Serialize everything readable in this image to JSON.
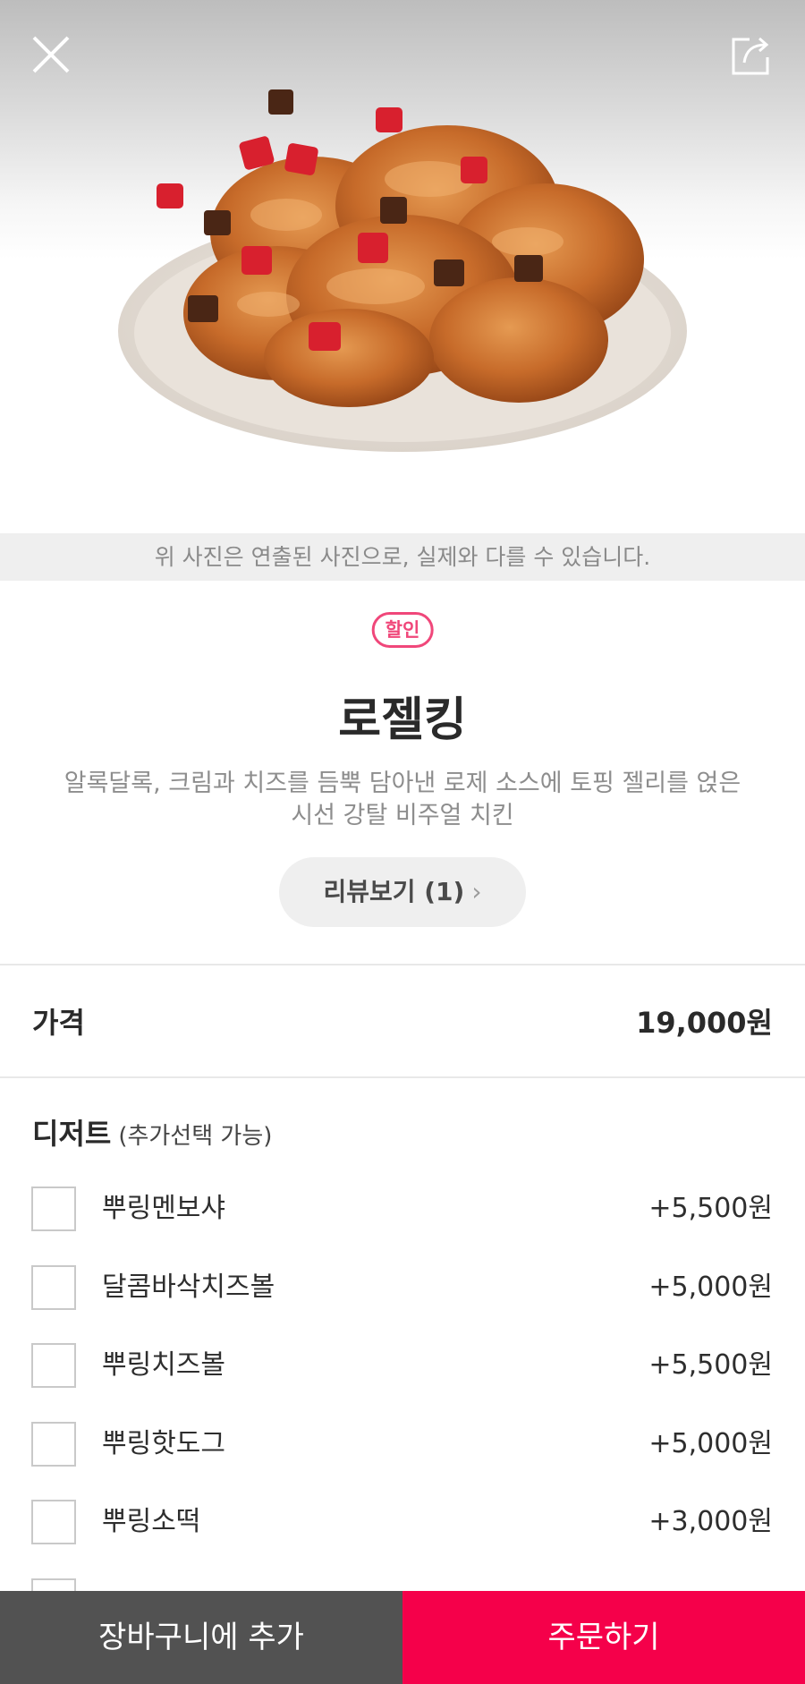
{
  "header": {
    "close_icon": "close-icon",
    "share_icon": "share-icon"
  },
  "photo": {
    "notice": "위 사진은 연출된 사진으로, 실제와 다를 수 있습니다."
  },
  "product": {
    "badge": "할인",
    "name": "로젤킹",
    "description": "알록달록, 크림과 치즈를 듬뿍 담아낸 로제 소스에 토핑 젤리를 얹은 시선 강탈 비주얼 치킨",
    "review_label": "리뷰보기 (1)",
    "review_chevron": "›"
  },
  "price": {
    "label": "가격",
    "value": "19,000원"
  },
  "dessert": {
    "title": "디저트",
    "note": "(추가선택 가능)",
    "options": [
      {
        "name": "뿌링멘보샤",
        "price": "+5,500원"
      },
      {
        "name": "달콤바삭치즈볼",
        "price": "+5,000원"
      },
      {
        "name": "뿌링치즈볼",
        "price": "+5,500원"
      },
      {
        "name": "뿌링핫도그",
        "price": "+5,000원"
      },
      {
        "name": "뿌링소떡",
        "price": "+3,000원"
      }
    ]
  },
  "actions": {
    "cart": "장바구니에 추가",
    "order": "주문하기"
  },
  "colors": {
    "accent": "#f5004a",
    "badge": "#f0477a",
    "cart_button": "#525252"
  }
}
